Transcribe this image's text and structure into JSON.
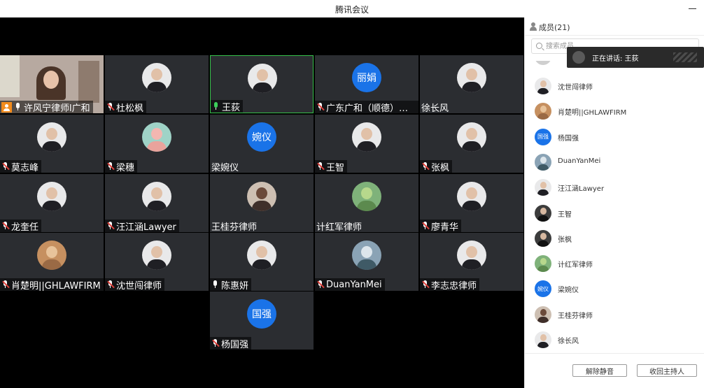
{
  "window": {
    "title": "腾讯会议"
  },
  "video_grid": {
    "tiles": [
      {
        "name": "许风宁律师l广和",
        "mic": "on",
        "type": "camera",
        "host_badge": true
      },
      {
        "name": "杜松枫",
        "mic": "muted",
        "avatar": "photo"
      },
      {
        "name": "王荻",
        "mic": "active",
        "avatar": "photo",
        "speaking": true
      },
      {
        "name": "广东广和（顺德）律…",
        "mic": "muted",
        "avatar_text": "丽娟"
      },
      {
        "name": "徐长风",
        "mic": "none",
        "avatar": "photo"
      },
      {
        "name": "莫志峰",
        "mic": "muted",
        "avatar": "photo"
      },
      {
        "name": "梁穗",
        "mic": "muted",
        "avatar": "flower"
      },
      {
        "name": "梁婉仪",
        "mic": "none",
        "avatar_text": "婉仪"
      },
      {
        "name": "王智",
        "mic": "muted",
        "avatar": "photo"
      },
      {
        "name": "张枫",
        "mic": "muted",
        "avatar": "photo"
      },
      {
        "name": "龙奎任",
        "mic": "muted",
        "avatar": "photo"
      },
      {
        "name": "汪江涵Lawyer",
        "mic": "muted",
        "avatar": "photo"
      },
      {
        "name": "王桂芬律师",
        "mic": "none",
        "avatar": "room"
      },
      {
        "name": "计红军律师",
        "mic": "none",
        "avatar": "green"
      },
      {
        "name": "廖青华",
        "mic": "muted",
        "avatar": "photo"
      },
      {
        "name": "肖楚明||GHLAWFIRM",
        "mic": "muted",
        "avatar": "bear"
      },
      {
        "name": "沈世闯律师",
        "mic": "muted",
        "avatar": "photo"
      },
      {
        "name": "陈惠妍",
        "mic": "on",
        "avatar": "photo"
      },
      {
        "name": "DuanYanMei",
        "mic": "muted",
        "avatar": "lake"
      },
      {
        "name": "李志忠律师",
        "mic": "muted",
        "avatar": "photo"
      },
      {
        "name": "杨国强",
        "mic": "muted",
        "avatar_text": "国强"
      }
    ]
  },
  "panel": {
    "title": "成员(21)",
    "search_placeholder": "搜索成员",
    "speaking_toast": "正在讲话: 王荻",
    "members": [
      {
        "name": "沈世闯律师",
        "avatar": "photo"
      },
      {
        "name": "肖楚明||GHLAWFIRM",
        "avatar": "bear"
      },
      {
        "name": "杨国强",
        "avatar_text": "国强"
      },
      {
        "name": "DuanYanMei",
        "avatar": "lake"
      },
      {
        "name": "汪江涵Lawyer",
        "avatar": "photo"
      },
      {
        "name": "王智",
        "avatar": "dark"
      },
      {
        "name": "张枫",
        "avatar": "dark"
      },
      {
        "name": "计红军律师",
        "avatar": "green"
      },
      {
        "name": "梁婉仪",
        "avatar_text": "婉仪"
      },
      {
        "name": "王桂芬律师",
        "avatar": "room"
      },
      {
        "name": "徐长风",
        "avatar": "photo"
      }
    ],
    "buttons": {
      "unmute": "解除静音",
      "reclaim_host": "收回主持人"
    }
  },
  "colors": {
    "tile_bg": "#2b2d31",
    "video_bg": "#000000",
    "accent_blue": "#1a73e8",
    "speaking_green": "#35c04a",
    "muted_red": "#e0403a",
    "host_orange": "#f28b1c"
  }
}
